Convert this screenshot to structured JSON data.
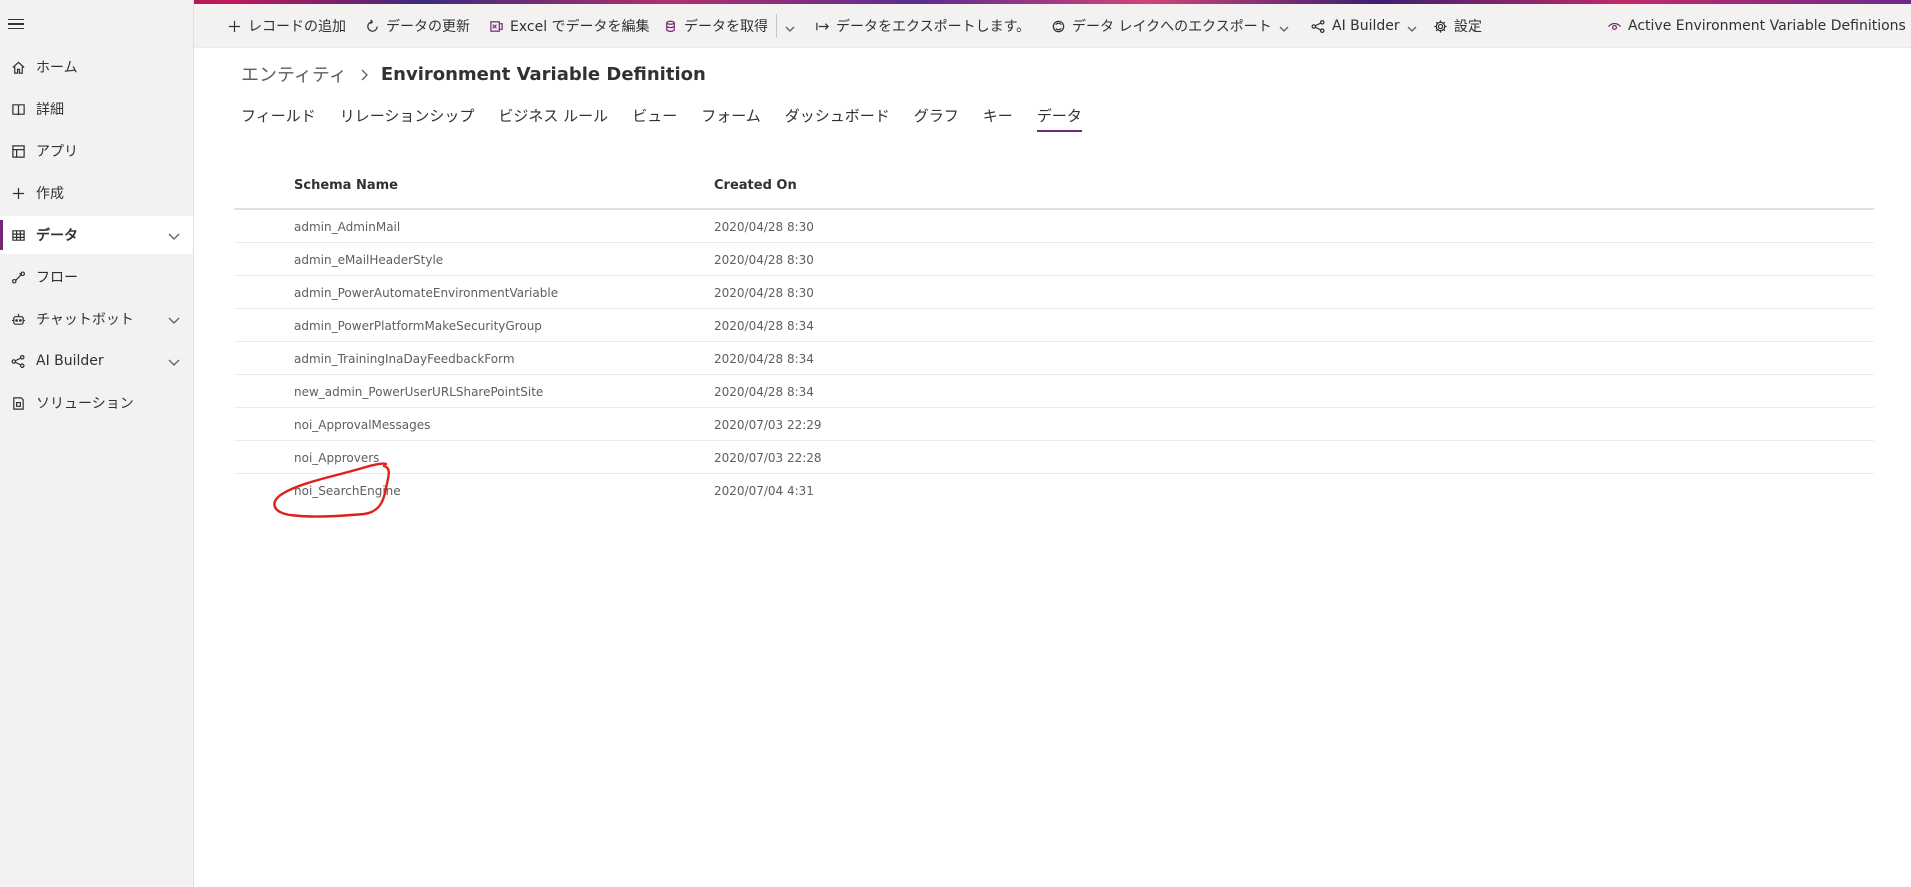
{
  "sidebar": {
    "items": [
      {
        "label": "ホーム",
        "icon": "home-icon"
      },
      {
        "label": "詳細",
        "icon": "book-icon"
      },
      {
        "label": "アプリ",
        "icon": "apps-icon"
      },
      {
        "label": "作成",
        "icon": "plus-icon"
      },
      {
        "label": "データ",
        "icon": "table-icon",
        "selected": true,
        "expandable": true
      },
      {
        "label": "フロー",
        "icon": "flow-icon"
      },
      {
        "label": "チャットボット",
        "icon": "bot-icon",
        "expandable": true
      },
      {
        "label": "AI Builder",
        "icon": "ai-builder-icon",
        "expandable": true
      },
      {
        "label": "ソリューション",
        "icon": "solution-icon"
      }
    ]
  },
  "toolbar": {
    "add_record": "レコードの追加",
    "refresh": "データの更新",
    "excel_edit": "Excel でデータを編集",
    "get_data": "データを取得",
    "export_data": "データをエクスポートします。",
    "export_datalake": "データ レイクへのエクスポート",
    "ai_builder": "AI Builder",
    "settings": "設定",
    "view_selector": "Active Environment Variable Definitions"
  },
  "breadcrumb": {
    "parent": "エンティティ",
    "current": "Environment Variable Definition"
  },
  "tabs": [
    {
      "label": "フィールド"
    },
    {
      "label": "リレーションシップ"
    },
    {
      "label": "ビジネス ルール"
    },
    {
      "label": "ビュー"
    },
    {
      "label": "フォーム"
    },
    {
      "label": "ダッシュボード"
    },
    {
      "label": "グラフ"
    },
    {
      "label": "キー"
    },
    {
      "label": "データ",
      "active": true
    }
  ],
  "table": {
    "headers": {
      "schema_name": "Schema Name",
      "created_on": "Created On"
    },
    "rows": [
      {
        "schema_name": "admin_AdminMail",
        "created_on": "2020/04/28 8:30"
      },
      {
        "schema_name": "admin_eMailHeaderStyle",
        "created_on": "2020/04/28 8:30"
      },
      {
        "schema_name": "admin_PowerAutomateEnvironmentVariable",
        "created_on": "2020/04/28 8:30"
      },
      {
        "schema_name": "admin_PowerPlatformMakeSecurityGroup",
        "created_on": "2020/04/28 8:34"
      },
      {
        "schema_name": "admin_TrainingInaDayFeedbackForm",
        "created_on": "2020/04/28 8:34"
      },
      {
        "schema_name": "new_admin_PowerUserURLSharePointSite",
        "created_on": "2020/04/28 8:34"
      },
      {
        "schema_name": "noi_ApprovalMessages",
        "created_on": "2020/07/03 22:29"
      },
      {
        "schema_name": "noi_Approvers",
        "created_on": "2020/07/03 22:28"
      },
      {
        "schema_name": "noi_SearchEngine",
        "created_on": "2020/07/04 4:31"
      }
    ]
  },
  "colors": {
    "accent": "#742774",
    "annotation": "#e0201c",
    "sidebar_bg": "#f3f2f1"
  }
}
